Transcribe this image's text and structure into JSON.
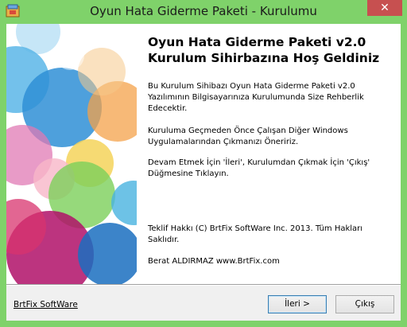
{
  "window": {
    "title": "Oyun Hata Giderme Paketi - Kurulumu",
    "close_glyph": "✕",
    "icon": "installer-app-icon",
    "frame_color": "#7fd26a"
  },
  "welcome": {
    "heading_line1": "Oyun Hata Giderme Paketi v2.0",
    "heading_line2": "Kurulum Sihirbazına Hoş Geldiniz",
    "para1": "Bu Kurulum Sihibazı Oyun Hata Giderme Paketi v2.0 Yazılımının Bilgisayarınıza Kurulumunda Size Rehberlik Edecektir.",
    "para2": "Kuruluma Geçmeden Önce Çalışan Diğer Windows Uygulamalarından Çıkmanızı Öneririz.",
    "para3": "Devam Etmek İçin 'İleri', Kurulumdan Çıkmak İçin 'Çıkış' Düğmesine Tıklayın.",
    "copyright": "Teklif Hakkı (C) BrtFix SoftWare Inc. 2013. Tüm Hakları Saklıdır.",
    "author": "Berat ALDIRMAZ www.BrtFix.com"
  },
  "footer": {
    "brand_link": "BrtFix SoftWare",
    "next_button": "İleri >",
    "exit_button": "Çıkış"
  }
}
